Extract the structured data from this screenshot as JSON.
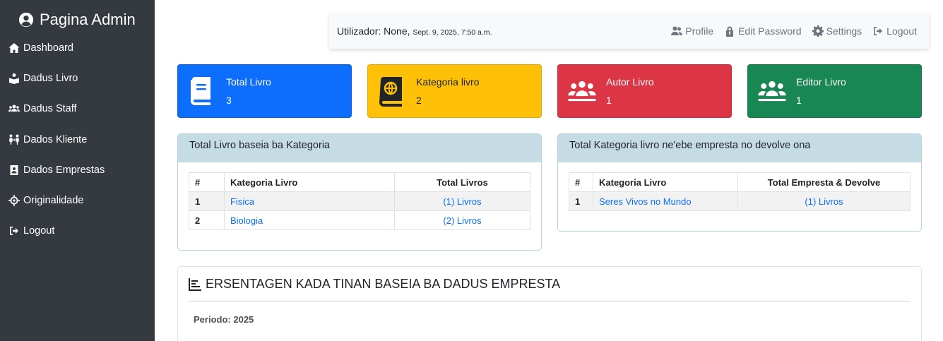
{
  "sidebar": {
    "brand": "Pagina Admin",
    "items": [
      {
        "label": "Dashboard",
        "icon": "home-icon"
      },
      {
        "label": "Dadus Livro",
        "icon": "book-open-reader-icon"
      },
      {
        "label": "Dadus Staff",
        "icon": "users-icon"
      },
      {
        "label": "Dados Kliente",
        "icon": "people-arrows-icon"
      },
      {
        "label": "Dados Emprestas",
        "icon": "address-book-icon"
      },
      {
        "label": "Originalidade",
        "icon": "crosshairs-icon"
      },
      {
        "label": "Logout",
        "icon": "sign-out-icon"
      }
    ]
  },
  "topbar": {
    "user_label": "Utilizador: None,",
    "timestamp": "Sept. 9, 2025, 7:50 a.m.",
    "links": {
      "profile": "Profile",
      "edit_password": "Edit Password",
      "settings": "Settings",
      "logout": "Logout"
    }
  },
  "stats": [
    {
      "title": "Total Livro",
      "value": "3",
      "color": "#0d6efd",
      "icon": "book-icon"
    },
    {
      "title": "Kategoria livro",
      "value": "2",
      "color": "#ffc107",
      "icon": "book-atlas-icon"
    },
    {
      "title": "Autor Livro",
      "value": "1",
      "color": "#dc3545",
      "icon": "users-icon"
    },
    {
      "title": "Editor Livro",
      "value": "1",
      "color": "#198754",
      "icon": "users-icon"
    }
  ],
  "panel_category": {
    "title": "Total Livro baseia ba Kategoria",
    "headers": [
      "#",
      "Kategoria Livro",
      "Total Livros"
    ],
    "rows": [
      {
        "num": "1",
        "category": "Fisica",
        "total": "(1) Livros"
      },
      {
        "num": "2",
        "category": "Biologia",
        "total": "(2) Livros"
      }
    ]
  },
  "panel_loans": {
    "title": "Total Kategoria livro ne'ebe empresta no devolve ona",
    "headers": [
      "#",
      "Kategoria Livro",
      "Total Empresta & Devolve"
    ],
    "rows": [
      {
        "num": "1",
        "category": "Seres Vivos no Mundo",
        "total": "(1) Livros"
      }
    ]
  },
  "chart_section": {
    "title": "ERSENTAGEN KADA TINAN BASEIA BA DADUS EMPRESTA",
    "period_label": "Periodo:",
    "period_value": "2025"
  }
}
